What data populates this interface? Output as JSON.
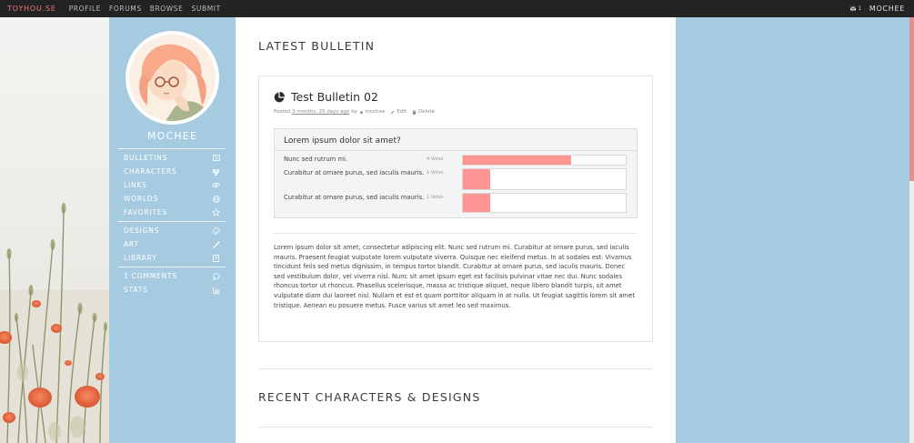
{
  "topnav": {
    "brand": "TOYHOU.SE",
    "links": [
      "PROFILE",
      "FORUMS",
      "BROWSE",
      "SUBMIT"
    ],
    "messages": "1",
    "user": "MOCHEE"
  },
  "sidebar": {
    "username": "MOCHEE",
    "groups": [
      [
        {
          "label": "BULLETINS",
          "icon": "newspaper-icon"
        },
        {
          "label": "CHARACTERS",
          "icon": "users-icon"
        },
        {
          "label": "LINKS",
          "icon": "link-icon"
        },
        {
          "label": "WORLDS",
          "icon": "globe-icon"
        },
        {
          "label": "FAVORITES",
          "icon": "star-icon"
        }
      ],
      [
        {
          "label": "DESIGNS",
          "icon": "palette-icon"
        },
        {
          "label": "ART",
          "icon": "brush-icon"
        },
        {
          "label": "LIBRARY",
          "icon": "book-icon"
        }
      ],
      [
        {
          "label": "1 COMMENTS",
          "icon": "comment-icon"
        },
        {
          "label": "STATS",
          "icon": "chart-icon"
        }
      ]
    ]
  },
  "main": {
    "latest_heading": "LATEST BULLETIN",
    "bulletin": {
      "title": "Test Bulletin 02",
      "posted": "Posted",
      "time": "3 months, 25 days ago",
      "by": "by",
      "author": "mochee",
      "edit": "Edit",
      "delete": "Delete",
      "poll": {
        "question": "Lorem ipsum dolor sit amet?",
        "options": [
          {
            "label": "Nunc sed rutrum mi.",
            "votes": "4 Votes",
            "share": 0.667
          },
          {
            "label": "Curabitur at ornare purus, sed iaculis mauris.",
            "votes": "1 Votes",
            "share": 0.167
          },
          {
            "label": "Curabitur at ornare purus, sed iaculis mauris.",
            "votes": "1 Votes",
            "share": 0.167
          }
        ]
      },
      "body": "Lorem ipsum dolor sit amet, consectetur adipiscing elit. Nunc sed rutrum mi. Curabitur at ornare purus, sed iaculis mauris. Praesent feugiat vulputate lorem vulputate viverra. Quisque nec eleifend metus. In at sodales est. Vivamus tincidunt felis sed metus dignissim, in tempus tortor blandit. Curabitur at ornare purus, sed iaculis mauris. Donec sed vestibulum dolor, vel viverra nisl. Nunc sit amet ipsum eget est facilisis pulvinar vitae nec dui. Nunc sodales rhoncus tortor ut rhoncus. Phasellus scelerisque, massa ac tristique aliquet, neque libero blandit turpis, sit amet vulputate diam dui laoreet nisl. Nullam et est et quam porttitor aliquam in at nulla. Ut feugiat sagittis lorem sit amet tristique. Aenean eu posuere metus. Fusce varius sit amet leo sed maximus."
    },
    "recent_heading": "RECENT CHARACTERS & DESIGNS"
  },
  "colors": {
    "accent": "#e8797e",
    "sidebar": "#a6cbe1",
    "poll_bar": "#ff9494",
    "topbar": "#232323"
  }
}
